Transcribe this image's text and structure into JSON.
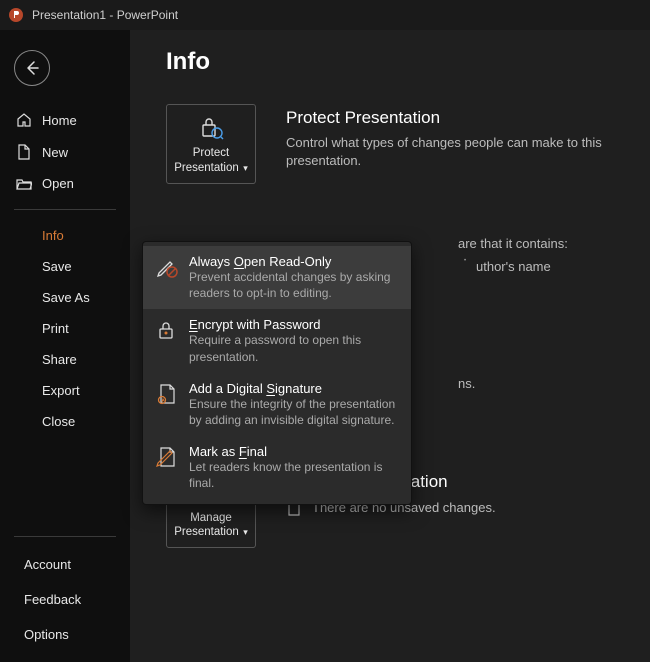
{
  "titlebar": {
    "title": "Presentation1 - PowerPoint"
  },
  "sidebar": {
    "home": "Home",
    "new": "New",
    "open": "Open",
    "info": "Info",
    "save": "Save",
    "saveAs": "Save As",
    "print": "Print",
    "share": "Share",
    "export": "Export",
    "close": "Close",
    "account": "Account",
    "feedback": "Feedback",
    "options": "Options"
  },
  "page": {
    "title": "Info"
  },
  "protect": {
    "buttonLine1": "Protect",
    "buttonLine2": "Presentation",
    "title": "Protect Presentation",
    "desc": "Control what types of changes people can make to this presentation."
  },
  "protectMenu": {
    "items": [
      {
        "titlePrefix": "Always ",
        "titleUnderline": "O",
        "titleSuffix": "pen Read-Only",
        "desc": "Prevent accidental changes by asking readers to opt-in to editing."
      },
      {
        "titlePrefix": "",
        "titleUnderline": "E",
        "titleSuffix": "ncrypt with Password",
        "desc": "Require a password to open this presentation."
      },
      {
        "titlePrefix": "Add a Digital ",
        "titleUnderline": "S",
        "titleSuffix": "ignature",
        "desc": "Ensure the integrity of the presentation by adding an invisible digital signature."
      },
      {
        "titlePrefix": "Mark as ",
        "titleUnderline": "F",
        "titleSuffix": "inal",
        "desc": "Let readers know the presentation is final."
      }
    ]
  },
  "inspect": {
    "visibleLine": "are that it contains:",
    "bullet1": "uthor's name",
    "visibleLine2": "ns."
  },
  "manage": {
    "buttonLine1": "Manage",
    "buttonLine2": "Presentation",
    "title": "Manage Presentation",
    "desc": "There are no unsaved changes."
  }
}
